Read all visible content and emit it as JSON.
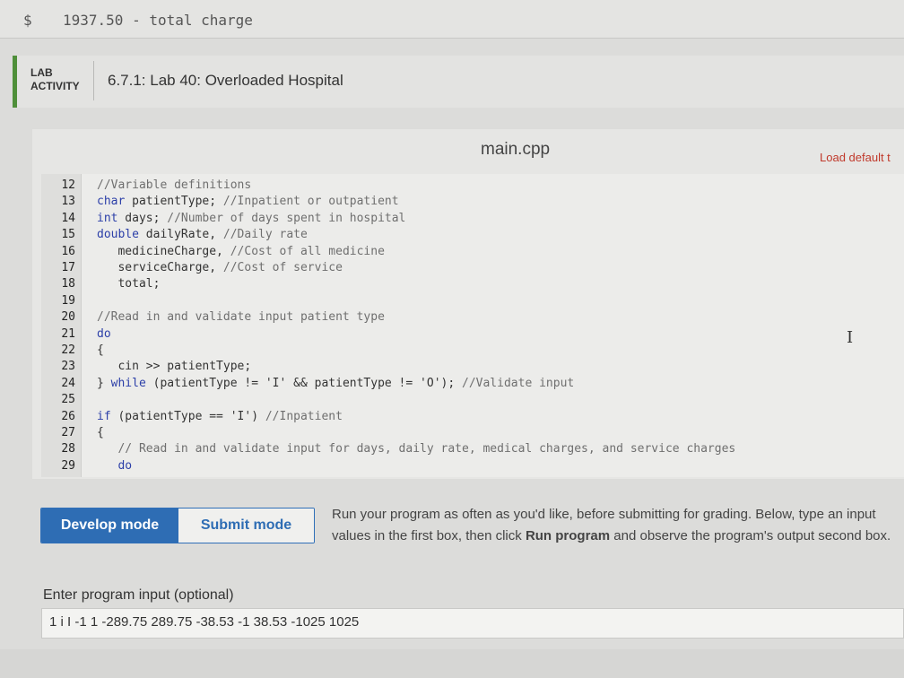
{
  "output": {
    "dollar": "$",
    "value": "1937.50 - total charge"
  },
  "lab": {
    "tag_line1": "LAB",
    "tag_line2": "ACTIVITY",
    "title": "6.7.1: Lab 40: Overloaded Hospital"
  },
  "editor": {
    "filename": "main.cpp",
    "load_default": "Load default t",
    "lines": [
      {
        "n": "12",
        "t": "//Variable definitions"
      },
      {
        "n": "13",
        "t": "char patientType; //Inpatient or outpatient"
      },
      {
        "n": "14",
        "t": "int days; //Number of days spent in hospital"
      },
      {
        "n": "15",
        "t": "double dailyRate, //Daily rate"
      },
      {
        "n": "16",
        "t": "   medicineCharge, //Cost of all medicine"
      },
      {
        "n": "17",
        "t": "   serviceCharge, //Cost of service"
      },
      {
        "n": "18",
        "t": "   total;"
      },
      {
        "n": "19",
        "t": ""
      },
      {
        "n": "20",
        "t": "//Read in and validate input patient type"
      },
      {
        "n": "21",
        "t": "do"
      },
      {
        "n": "22",
        "t": "{"
      },
      {
        "n": "23",
        "t": "   cin >> patientType;"
      },
      {
        "n": "24",
        "t": "} while (patientType != 'I' && patientType != 'O'); //Validate input"
      },
      {
        "n": "25",
        "t": ""
      },
      {
        "n": "26",
        "t": "if (patientType == 'I') //Inpatient"
      },
      {
        "n": "27",
        "t": "{"
      },
      {
        "n": "28",
        "t": "   // Read in and validate input for days, daily rate, medical charges, and service charges"
      },
      {
        "n": "29",
        "t": "   do"
      }
    ]
  },
  "modes": {
    "develop": "Develop mode",
    "submit": "Submit mode"
  },
  "run_info": {
    "part1": "Run your program as often as you'd like, before submitting for grading. Below, type an",
    "part2": "input values in the first box, then click ",
    "bold": "Run program",
    "part3": " and observe the program's output",
    "part4": "second box."
  },
  "input": {
    "label": "Enter program input (optional)",
    "value": "1 i I -1 1 -289.75 289.75 -38.53 -1 38.53 -1025 1025"
  }
}
